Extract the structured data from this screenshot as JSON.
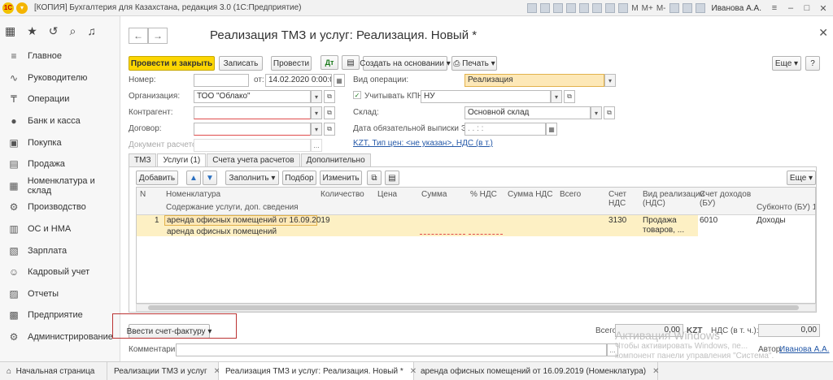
{
  "titlebar": {
    "logo": "1С",
    "title": "[КОПИЯ] Бухгалтерия для Казахстана, редакция 3.0 (1С:Предприятие)",
    "m_labels": [
      "M",
      "M+",
      "M-"
    ],
    "user": "Иванова А.А."
  },
  "sidebar": {
    "items": [
      {
        "label": "Главное",
        "icon": "≡"
      },
      {
        "label": "Руководителю",
        "icon": "∿"
      },
      {
        "label": "Операции",
        "icon": "₸"
      },
      {
        "label": "Банк и касса",
        "icon": "●"
      },
      {
        "label": "Покупка",
        "icon": "▣"
      },
      {
        "label": "Продажа",
        "icon": "▤"
      },
      {
        "label": "Номенклатура и склад",
        "icon": "▦"
      },
      {
        "label": "Производство",
        "icon": "⚙"
      },
      {
        "label": "ОС и НМА",
        "icon": "▥"
      },
      {
        "label": "Зарплата",
        "icon": "▧"
      },
      {
        "label": "Кадровый учет",
        "icon": "☺"
      },
      {
        "label": "Отчеты",
        "icon": "▨"
      },
      {
        "label": "Предприятие",
        "icon": "▩"
      },
      {
        "label": "Администрирование",
        "icon": "⚙"
      }
    ]
  },
  "form": {
    "title": "Реализация ТМЗ и услуг: Реализация. Новый *",
    "toolbar": {
      "post_close": "Провести и закрыть",
      "save": "Записать",
      "post": "Провести",
      "create_based": "Создать на основании",
      "print": "Печать",
      "more": "Еще"
    },
    "fields": {
      "number_label": "Номер:",
      "number_value": "",
      "from_label": "от:",
      "date_value": "14.02.2020  0:00:00",
      "operation_label": "Вид операции:",
      "operation_value": "Реализация",
      "org_label": "Организация:",
      "org_value": "ТОО \"Облако\"",
      "kpn_label": "Учитывать КПН",
      "kpn_value": "НУ",
      "contractor_label": "Контрагент:",
      "contractor_value": "",
      "warehouse_label": "Склад:",
      "warehouse_value": "Основной склад",
      "contract_label": "Договор:",
      "contract_value": "",
      "esf_label": "Дата обязательной выписки ЭСФ:",
      "esf_value": ". .   : :",
      "payment_doc_label": "Документ расчетов:",
      "payment_doc_value": "",
      "price_info": "KZT, Тип цен: <не указан>, НДС (в т.)"
    },
    "tabs": [
      "ТМЗ",
      "Услуги (1)",
      "Счета учета расчетов",
      "Дополнительно"
    ],
    "table_toolbar": {
      "add": "Добавить",
      "fill": "Заполнить",
      "pick": "Подбор",
      "change": "Изменить",
      "more": "Еще"
    },
    "table": {
      "headers": {
        "n": "N",
        "nomenclature": "Номенклатура",
        "content": "Содержание услуги, доп. сведения",
        "qty": "Количество",
        "price": "Цена",
        "sum": "Сумма",
        "vat_pct": "% НДС",
        "vat_sum": "Сумма НДС",
        "total": "Всего",
        "vat_account_1": "Счет",
        "vat_account_2": "НДС",
        "sale_type_1": "Вид реализации",
        "sale_type_2": "(НДС)",
        "income_account_1": "Счет доходов",
        "income_account_2": "(БУ)",
        "subconto": "Субконто (БУ) 1"
      },
      "rows": [
        {
          "n": "1",
          "nomenclature": "аренда офисных помещений от 16.09.2019",
          "content": "аренда офисных помещений",
          "vat_account": "3130",
          "sale_type_1": "Продажа",
          "sale_type_2": "товаров, ...",
          "income_account": "6010",
          "subconto": "Доходы"
        }
      ]
    },
    "footer": {
      "invoice_button": "Ввести счет-фактуру",
      "total_label": "Всего:",
      "total_value": "0,00",
      "currency": "KZT",
      "vat_label": "НДС (в т. ч.):",
      "vat_value": "0,00",
      "comment_label": "Комментарий:",
      "comment_value": "",
      "author_label": "Автор:",
      "author_value": "Иванова А.А."
    }
  },
  "bottom_tabs": [
    "Начальная страница",
    "Реализации ТМЗ и услуг",
    "Реализация ТМЗ и услуг: Реализация. Новый *",
    "аренда офисных помещений от 16.09.2019 (Номенклатура)"
  ],
  "watermark": {
    "line1": "Активация Windows",
    "line2": "Чтобы активировать Windows, пе...",
    "line3": "компонент панели управления \"Система\"."
  }
}
